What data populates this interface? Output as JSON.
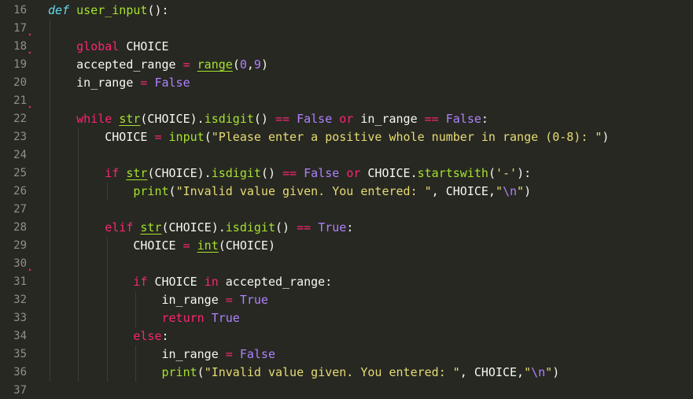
{
  "editor": {
    "language": "python",
    "theme_background": "#272822",
    "colors": {
      "keyword": "#f92672",
      "definition_keyword": "#66d9ef",
      "function": "#a6e22e",
      "constant": "#ae81ff",
      "string": "#e6db74",
      "plain": "#f8f8f2",
      "line_number": "#8f908a"
    },
    "lines": [
      {
        "number": "16",
        "tokens": [
          {
            "t": "def",
            "c": "kw-def"
          },
          {
            "t": " ",
            "c": "plain"
          },
          {
            "t": "user_input",
            "c": "fn"
          },
          {
            "t": "():",
            "c": "plain"
          }
        ]
      },
      {
        "number": "17",
        "tokens": []
      },
      {
        "number": "18",
        "fold": true,
        "tokens": [
          {
            "t": "    ",
            "c": "plain"
          },
          {
            "t": "global",
            "c": "kw"
          },
          {
            "t": " CHOICE",
            "c": "plain"
          }
        ]
      },
      {
        "number": "19",
        "fold": true,
        "tokens": [
          {
            "t": "    accepted_range ",
            "c": "plain"
          },
          {
            "t": "=",
            "c": "op"
          },
          {
            "t": " ",
            "c": "plain"
          },
          {
            "t": "range",
            "c": "builtin"
          },
          {
            "t": "(",
            "c": "plain"
          },
          {
            "t": "0",
            "c": "num"
          },
          {
            "t": ",",
            "c": "plain"
          },
          {
            "t": "9",
            "c": "num"
          },
          {
            "t": ")",
            "c": "plain"
          }
        ]
      },
      {
        "number": "20",
        "tokens": [
          {
            "t": "    in_range ",
            "c": "plain"
          },
          {
            "t": "=",
            "c": "op"
          },
          {
            "t": " ",
            "c": "plain"
          },
          {
            "t": "False",
            "c": "const"
          }
        ]
      },
      {
        "number": "21",
        "tokens": []
      },
      {
        "number": "22",
        "fold": true,
        "tokens": [
          {
            "t": "    ",
            "c": "plain"
          },
          {
            "t": "while",
            "c": "kw"
          },
          {
            "t": " ",
            "c": "plain"
          },
          {
            "t": "str",
            "c": "builtin"
          },
          {
            "t": "(CHOICE).",
            "c": "plain"
          },
          {
            "t": "isdigit",
            "c": "fn"
          },
          {
            "t": "() ",
            "c": "plain"
          },
          {
            "t": "==",
            "c": "op"
          },
          {
            "t": " ",
            "c": "plain"
          },
          {
            "t": "False",
            "c": "const"
          },
          {
            "t": " ",
            "c": "plain"
          },
          {
            "t": "or",
            "c": "kw"
          },
          {
            "t": " in_range ",
            "c": "plain"
          },
          {
            "t": "==",
            "c": "op"
          },
          {
            "t": " ",
            "c": "plain"
          },
          {
            "t": "False",
            "c": "const"
          },
          {
            "t": ":",
            "c": "plain"
          }
        ]
      },
      {
        "number": "23",
        "tokens": [
          {
            "t": "        CHOICE ",
            "c": "plain"
          },
          {
            "t": "=",
            "c": "op"
          },
          {
            "t": " ",
            "c": "plain"
          },
          {
            "t": "input",
            "c": "fn"
          },
          {
            "t": "(",
            "c": "plain"
          },
          {
            "t": "\"Please enter a positive whole number in range (0-8): \"",
            "c": "str"
          },
          {
            "t": ")",
            "c": "plain"
          }
        ]
      },
      {
        "number": "24",
        "tokens": []
      },
      {
        "number": "25",
        "tokens": [
          {
            "t": "        ",
            "c": "plain"
          },
          {
            "t": "if",
            "c": "kw"
          },
          {
            "t": " ",
            "c": "plain"
          },
          {
            "t": "str",
            "c": "builtin"
          },
          {
            "t": "(CHOICE).",
            "c": "plain"
          },
          {
            "t": "isdigit",
            "c": "fn"
          },
          {
            "t": "() ",
            "c": "plain"
          },
          {
            "t": "==",
            "c": "op"
          },
          {
            "t": " ",
            "c": "plain"
          },
          {
            "t": "False",
            "c": "const"
          },
          {
            "t": " ",
            "c": "plain"
          },
          {
            "t": "or",
            "c": "kw"
          },
          {
            "t": " CHOICE.",
            "c": "plain"
          },
          {
            "t": "startswith",
            "c": "fn"
          },
          {
            "t": "(",
            "c": "plain"
          },
          {
            "t": "'-'",
            "c": "str"
          },
          {
            "t": "):",
            "c": "plain"
          }
        ]
      },
      {
        "number": "26",
        "tokens": [
          {
            "t": "            ",
            "c": "plain"
          },
          {
            "t": "print",
            "c": "fn"
          },
          {
            "t": "(",
            "c": "plain"
          },
          {
            "t": "\"Invalid value given. You entered: \"",
            "c": "str"
          },
          {
            "t": ", CHOICE,",
            "c": "plain"
          },
          {
            "t": "\"",
            "c": "str"
          },
          {
            "t": "\\n",
            "c": "esc"
          },
          {
            "t": "\"",
            "c": "str"
          },
          {
            "t": ")",
            "c": "plain"
          }
        ]
      },
      {
        "number": "27",
        "tokens": []
      },
      {
        "number": "28",
        "tokens": [
          {
            "t": "        ",
            "c": "plain"
          },
          {
            "t": "elif",
            "c": "kw"
          },
          {
            "t": " ",
            "c": "plain"
          },
          {
            "t": "str",
            "c": "builtin"
          },
          {
            "t": "(CHOICE).",
            "c": "plain"
          },
          {
            "t": "isdigit",
            "c": "fn"
          },
          {
            "t": "() ",
            "c": "plain"
          },
          {
            "t": "==",
            "c": "op"
          },
          {
            "t": " ",
            "c": "plain"
          },
          {
            "t": "True",
            "c": "const"
          },
          {
            "t": ":",
            "c": "plain"
          }
        ]
      },
      {
        "number": "29",
        "tokens": [
          {
            "t": "            CHOICE ",
            "c": "plain"
          },
          {
            "t": "=",
            "c": "op"
          },
          {
            "t": " ",
            "c": "plain"
          },
          {
            "t": "int",
            "c": "builtin"
          },
          {
            "t": "(CHOICE)",
            "c": "plain"
          }
        ]
      },
      {
        "number": "30",
        "tokens": []
      },
      {
        "number": "31",
        "fold": true,
        "tokens": [
          {
            "t": "            ",
            "c": "plain"
          },
          {
            "t": "if",
            "c": "kw"
          },
          {
            "t": " CHOICE ",
            "c": "plain"
          },
          {
            "t": "in",
            "c": "kw"
          },
          {
            "t": " accepted_range:",
            "c": "plain"
          }
        ]
      },
      {
        "number": "32",
        "tokens": [
          {
            "t": "                in_range ",
            "c": "plain"
          },
          {
            "t": "=",
            "c": "op"
          },
          {
            "t": " ",
            "c": "plain"
          },
          {
            "t": "True",
            "c": "const"
          }
        ]
      },
      {
        "number": "33",
        "tokens": [
          {
            "t": "                ",
            "c": "plain"
          },
          {
            "t": "return",
            "c": "kw"
          },
          {
            "t": " ",
            "c": "plain"
          },
          {
            "t": "True",
            "c": "const"
          }
        ]
      },
      {
        "number": "34",
        "tokens": [
          {
            "t": "            ",
            "c": "plain"
          },
          {
            "t": "else",
            "c": "kw"
          },
          {
            "t": ":",
            "c": "plain"
          }
        ]
      },
      {
        "number": "35",
        "tokens": [
          {
            "t": "                in_range ",
            "c": "plain"
          },
          {
            "t": "=",
            "c": "op"
          },
          {
            "t": " ",
            "c": "plain"
          },
          {
            "t": "False",
            "c": "const"
          }
        ]
      },
      {
        "number": "36",
        "tokens": [
          {
            "t": "                ",
            "c": "plain"
          },
          {
            "t": "print",
            "c": "fn"
          },
          {
            "t": "(",
            "c": "plain"
          },
          {
            "t": "\"Invalid value given. You entered: \"",
            "c": "str"
          },
          {
            "t": ", CHOICE,",
            "c": "plain"
          },
          {
            "t": "\"",
            "c": "str"
          },
          {
            "t": "\\n",
            "c": "esc"
          },
          {
            "t": "\"",
            "c": "str"
          },
          {
            "t": ")",
            "c": "plain"
          }
        ]
      },
      {
        "number": "37",
        "tokens": []
      }
    ]
  }
}
